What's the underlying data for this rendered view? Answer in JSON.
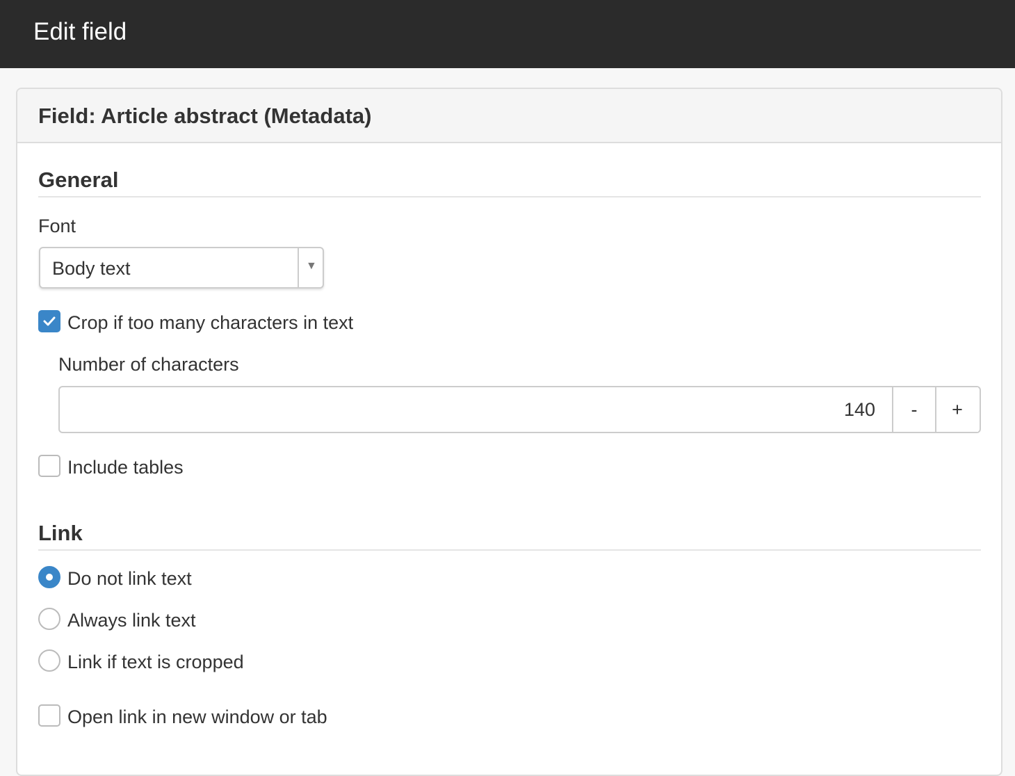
{
  "window": {
    "title": "Edit field"
  },
  "panel": {
    "title": "Field: Article abstract (Metadata)"
  },
  "general": {
    "heading": "General",
    "font_label": "Font",
    "font_value": "Body text",
    "crop_label": "Crop if too many characters in text",
    "crop_checked": true,
    "num_chars_label": "Number of characters",
    "num_chars_value": "140",
    "minus_label": "-",
    "plus_label": "+",
    "include_tables_label": "Include tables",
    "include_tables_checked": false
  },
  "link": {
    "heading": "Link",
    "options": [
      {
        "label": "Do not link text",
        "selected": true
      },
      {
        "label": "Always link text",
        "selected": false
      },
      {
        "label": "Link if text is cropped",
        "selected": false
      }
    ],
    "new_window_label": "Open link in new window or tab",
    "new_window_checked": false
  },
  "colors": {
    "topbar": "#2b2b2b",
    "accent": "#3a86c8",
    "border": "#cccccc"
  },
  "icons": {
    "select_caret": "caret-down-icon",
    "checkmark": "check-icon"
  }
}
